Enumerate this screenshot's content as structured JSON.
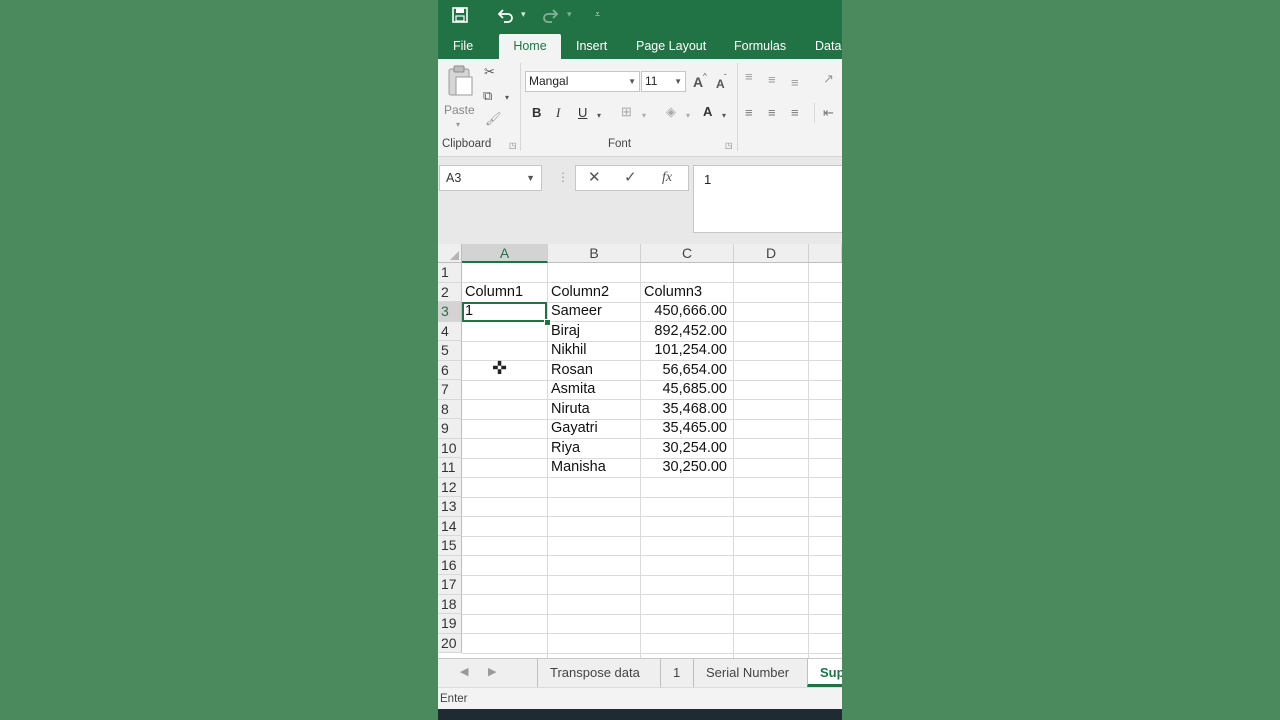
{
  "colors": {
    "brand": "#217346",
    "background": "#4a8a5c"
  },
  "quick_access": {
    "save_icon": "save-icon",
    "undo_icon": "undo-icon",
    "redo_icon": "redo-icon",
    "customize_icon": "customize-qat-icon"
  },
  "ribbon_tabs": [
    "File",
    "Home",
    "Insert",
    "Page Layout",
    "Formulas",
    "Data"
  ],
  "active_tab": "Home",
  "clipboard": {
    "paste_label": "Paste",
    "group_label": "Clipboard"
  },
  "font": {
    "name": "Mangal",
    "size": "11",
    "group_label": "Font",
    "bold": "B",
    "italic": "I",
    "underline": "U",
    "grow": "A",
    "shrink": "A",
    "color": "A"
  },
  "formula_bar": {
    "name_box": "A3",
    "cancel": "✕",
    "enter": "✓",
    "fx": "fx",
    "value": "1"
  },
  "columns": [
    "A",
    "B",
    "C",
    "D"
  ],
  "rows": [
    "1",
    "2",
    "3",
    "4",
    "5",
    "6",
    "7",
    "8",
    "9",
    "10",
    "11",
    "12",
    "13",
    "14",
    "15",
    "16",
    "17",
    "18",
    "19",
    "20"
  ],
  "headers": {
    "a": "Column1",
    "b": "Column2",
    "c": "Column3"
  },
  "cells_a": {
    "row3": "1"
  },
  "names": [
    "Sameer",
    "Biraj",
    "Nikhil",
    "Rosan",
    "Asmita",
    "Niruta",
    "Gayatri",
    "Riya",
    "Manisha"
  ],
  "amounts": [
    "450,666.00",
    "892,452.00",
    "101,254.00",
    "56,654.00",
    "45,685.00",
    "35,468.00",
    "35,465.00",
    "30,254.00",
    "30,250.00"
  ],
  "sheet_tabs": [
    "Transpose data",
    "1",
    "Serial Number",
    "Sup"
  ],
  "active_sheet": "Sup",
  "status": {
    "mode": "Enter"
  }
}
